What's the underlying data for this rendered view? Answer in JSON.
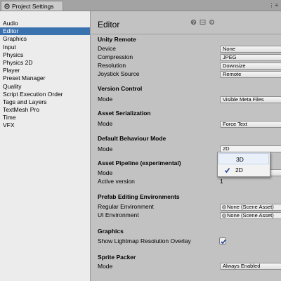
{
  "window": {
    "tab_title": "Project Settings",
    "tab_icon": "settings-gear-icon",
    "tab_menu_glyph": "⋮≡"
  },
  "sidebar": {
    "items": [
      {
        "label": "Audio",
        "selected": false
      },
      {
        "label": "Editor",
        "selected": true
      },
      {
        "label": "Graphics",
        "selected": false
      },
      {
        "label": "Input",
        "selected": false
      },
      {
        "label": "Physics",
        "selected": false
      },
      {
        "label": "Physics 2D",
        "selected": false
      },
      {
        "label": "Player",
        "selected": false
      },
      {
        "label": "Preset Manager",
        "selected": false
      },
      {
        "label": "Quality",
        "selected": false
      },
      {
        "label": "Script Execution Order",
        "selected": false
      },
      {
        "label": "Tags and Layers",
        "selected": false
      },
      {
        "label": "TextMesh Pro",
        "selected": false
      },
      {
        "label": "Time",
        "selected": false
      },
      {
        "label": "VFX",
        "selected": false
      }
    ],
    "selected_color": "#3a72b0"
  },
  "main": {
    "title": "Editor",
    "toolbar_icons": [
      "help-icon",
      "preset-icon",
      "settings-icon"
    ],
    "unity_remote": {
      "title": "Unity Remote",
      "device_label": "Device",
      "device_value": "None",
      "compression_label": "Compression",
      "compression_value": "JPEG",
      "resolution_label": "Resolution",
      "resolution_value": "Downsize",
      "joystick_label": "Joystick Source",
      "joystick_value": "Remote"
    },
    "version_control": {
      "title": "Version Control",
      "mode_label": "Mode",
      "mode_value": "Visible Meta Files"
    },
    "asset_serialization": {
      "title": "Asset Serialization",
      "mode_label": "Mode",
      "mode_value": "Force Text"
    },
    "default_behaviour": {
      "title": "Default Behaviour Mode",
      "mode_label": "Mode",
      "mode_value": "2D"
    },
    "asset_pipeline": {
      "title": "Asset Pipeline (experimental)",
      "mode_label": "Mode",
      "active_version_label": "Active version",
      "active_version_value": "1"
    },
    "prefab_editing": {
      "title": "Prefab Editing Environments",
      "regular_label": "Regular Environment",
      "regular_value": "None (Scene Asset)",
      "ui_label": "UI Environment",
      "ui_value": "None (Scene Asset)"
    },
    "graphics": {
      "title": "Graphics",
      "lightmap_label": "Show Lightmap Resolution Overlay",
      "lightmap_checked": true
    },
    "sprite_packer": {
      "title": "Sprite Packer",
      "mode_label": "Mode",
      "mode_value": "Always Enabled"
    }
  },
  "popup": {
    "options": [
      {
        "label": "3D",
        "checked": false,
        "hover": true
      },
      {
        "label": "2D",
        "checked": true,
        "hover": false
      }
    ]
  }
}
